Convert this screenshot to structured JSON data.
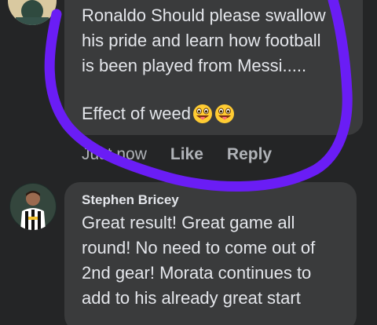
{
  "comments": [
    {
      "author": "",
      "lines": "Ronaldo Should please swallow\nhis pride and learn how football\nis been played from Messi.....",
      "extra_line": "Effect of weed",
      "emoji_icons": [
        "grinning-tongue-out-emoji",
        "grinning-tongue-out-emoji"
      ],
      "timestamp": "Just now",
      "like_label": "Like",
      "reply_label": "Reply"
    },
    {
      "author": "Stephen Bricey",
      "lines": "Great result! Great game all\nround! No need to come out of\n2nd gear! Morata continues to\nadd to his already great start"
    }
  ],
  "annotation": {
    "color": "#6a1df5"
  },
  "colors": {
    "background": "#242526",
    "bubble": "#3a3b3c",
    "text": "#e4e6eb",
    "muted": "#b0b3b8"
  }
}
